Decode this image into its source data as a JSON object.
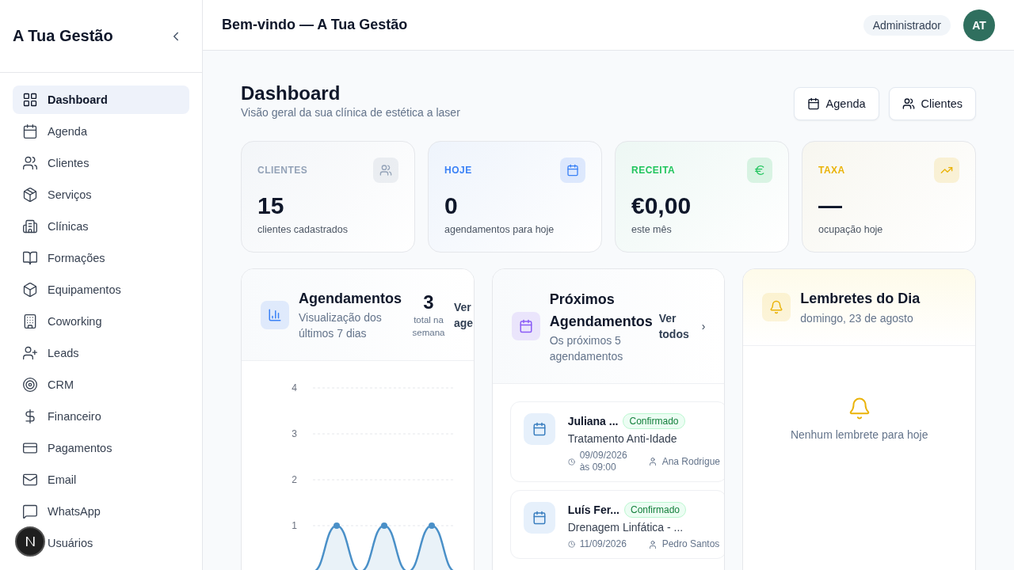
{
  "sidebar": {
    "title": "A Tua Gestão",
    "items": [
      {
        "label": "Dashboard",
        "selected": true
      },
      {
        "label": "Agenda",
        "selected": false
      },
      {
        "label": "Clientes",
        "selected": false
      },
      {
        "label": "Serviços",
        "selected": false
      },
      {
        "label": "Clínicas",
        "selected": false
      },
      {
        "label": "Formações",
        "selected": false
      },
      {
        "label": "Equipamentos",
        "selected": false
      },
      {
        "label": "Coworking",
        "selected": false
      },
      {
        "label": "Leads",
        "selected": false
      },
      {
        "label": "CRM",
        "selected": false
      },
      {
        "label": "Financeiro",
        "selected": false
      },
      {
        "label": "Pagamentos",
        "selected": false
      },
      {
        "label": "Email",
        "selected": false
      },
      {
        "label": "WhatsApp",
        "selected": false
      },
      {
        "label": "Usuários",
        "selected": false
      }
    ]
  },
  "header": {
    "title": "Bem-vindo — A Tua Gestão",
    "role": "Administrador",
    "avatar": "AT"
  },
  "page": {
    "title": "Dashboard",
    "subtitle": "Visão geral da sua clínica de estética a laser",
    "buttons": [
      "Agenda",
      "Clientes"
    ]
  },
  "stats": [
    {
      "label": "CLIENTES",
      "value": "15",
      "caption": "clientes cadastrados",
      "color": "#94a3b8"
    },
    {
      "label": "HOJE",
      "value": "0",
      "caption": "agendamentos para hoje",
      "color": "#3b82f6"
    },
    {
      "label": "RECEITA",
      "value": "€0,00",
      "caption": "este mês",
      "color": "#22c55e"
    },
    {
      "label": "TAXA",
      "value": "—",
      "caption": "ocupação hoje",
      "color": "#eab308"
    }
  ],
  "appointments_chart": {
    "title": "Agendamentos",
    "subtitle": "Visualização dos últimos 7 dias",
    "total": "3",
    "total_label": "total na semana",
    "link": "Ver age",
    "y_axis_labels": [
      "4",
      "3",
      "2",
      "1"
    ]
  },
  "upcoming": {
    "title": "Próximos Agendamentos",
    "subtitle": "Os próximos 5 agendamentos",
    "link": "Ver todos",
    "link_icon": "›",
    "items": [
      {
        "client": "Juliana ...",
        "status": "Confirmado",
        "service": "Tratamento Anti-Idade",
        "date": "09/09/2026",
        "time": "às 09:00",
        "staff": "Ana Rodrigue"
      },
      {
        "client": "Luís Fer...",
        "status": "Confirmado",
        "service": "Drenagem Linfática - ...",
        "date": "11/09/2026",
        "staff": "Pedro Santos"
      }
    ]
  },
  "reminders": {
    "title": "Lembretes do Dia",
    "date": "domingo, 23 de agosto",
    "empty": "Nenhum lembrete para hoje"
  }
}
